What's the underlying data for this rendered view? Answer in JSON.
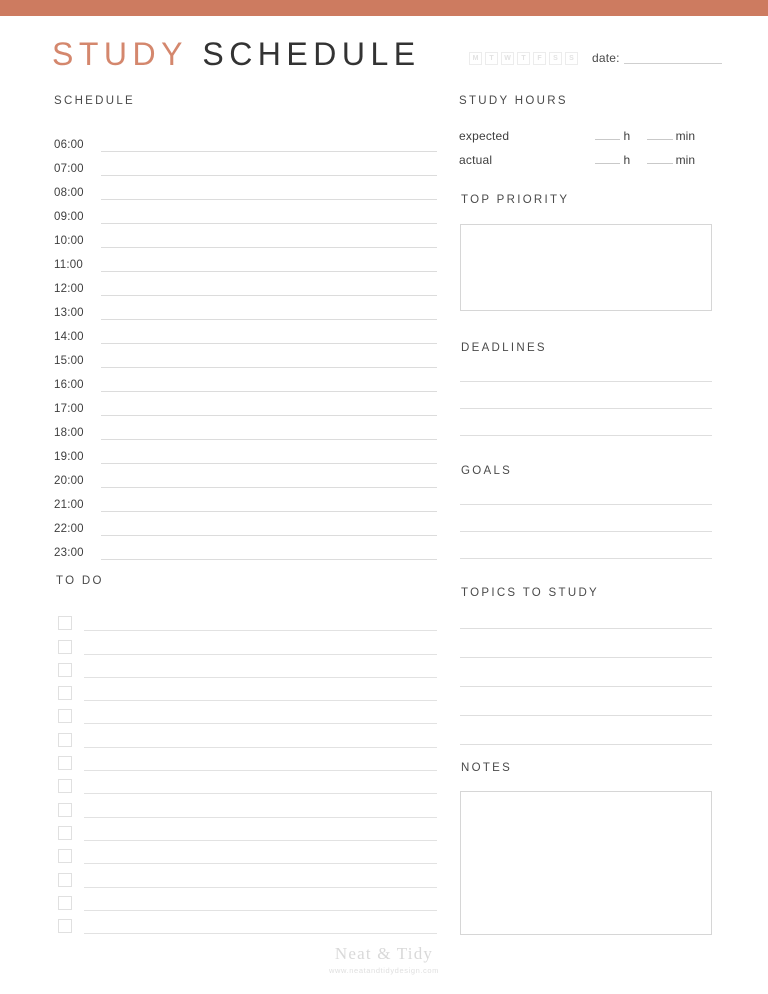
{
  "accent_color": "#cd7b60",
  "title": {
    "part_one": "STUDY",
    "part_two": "SCHEDULE",
    "part_one_color": "#d4876d",
    "part_two_color": "#333333"
  },
  "header": {
    "days": [
      "M",
      "T",
      "W",
      "T",
      "F",
      "S",
      "S"
    ],
    "date_label": "date:"
  },
  "schedule": {
    "heading": "SCHEDULE",
    "times": [
      "06:00",
      "07:00",
      "08:00",
      "09:00",
      "10:00",
      "11:00",
      "12:00",
      "13:00",
      "14:00",
      "15:00",
      "16:00",
      "17:00",
      "18:00",
      "19:00",
      "20:00",
      "21:00",
      "22:00",
      "23:00"
    ]
  },
  "todo": {
    "heading": "TO DO",
    "row_count": 14,
    "items": [
      "",
      "",
      "",
      "",
      "",
      "",
      "",
      "",
      "",
      "",
      "",
      "",
      "",
      ""
    ]
  },
  "study_hours": {
    "heading": "STUDY HOURS",
    "rows": [
      {
        "label": "expected",
        "hours_value": "",
        "hours_unit": "h",
        "minutes_value": "",
        "minutes_unit": "min"
      },
      {
        "label": "actual",
        "hours_value": "",
        "hours_unit": "h",
        "minutes_value": "",
        "minutes_unit": "min"
      }
    ]
  },
  "top_priority": {
    "heading": "TOP PRIORITY",
    "value": ""
  },
  "deadlines": {
    "heading": "DEADLINES",
    "line_count": 3,
    "items": [
      "",
      "",
      ""
    ]
  },
  "goals": {
    "heading": "GOALS",
    "line_count": 3,
    "items": [
      "",
      "",
      ""
    ]
  },
  "topics": {
    "heading": "TOPICS TO STUDY",
    "line_count": 5,
    "items": [
      "",
      "",
      "",
      "",
      ""
    ]
  },
  "notes": {
    "heading": "NOTES",
    "value": ""
  },
  "footer": {
    "brand": "Neat & Tidy",
    "website": "www.neatandtidydesign.com"
  }
}
